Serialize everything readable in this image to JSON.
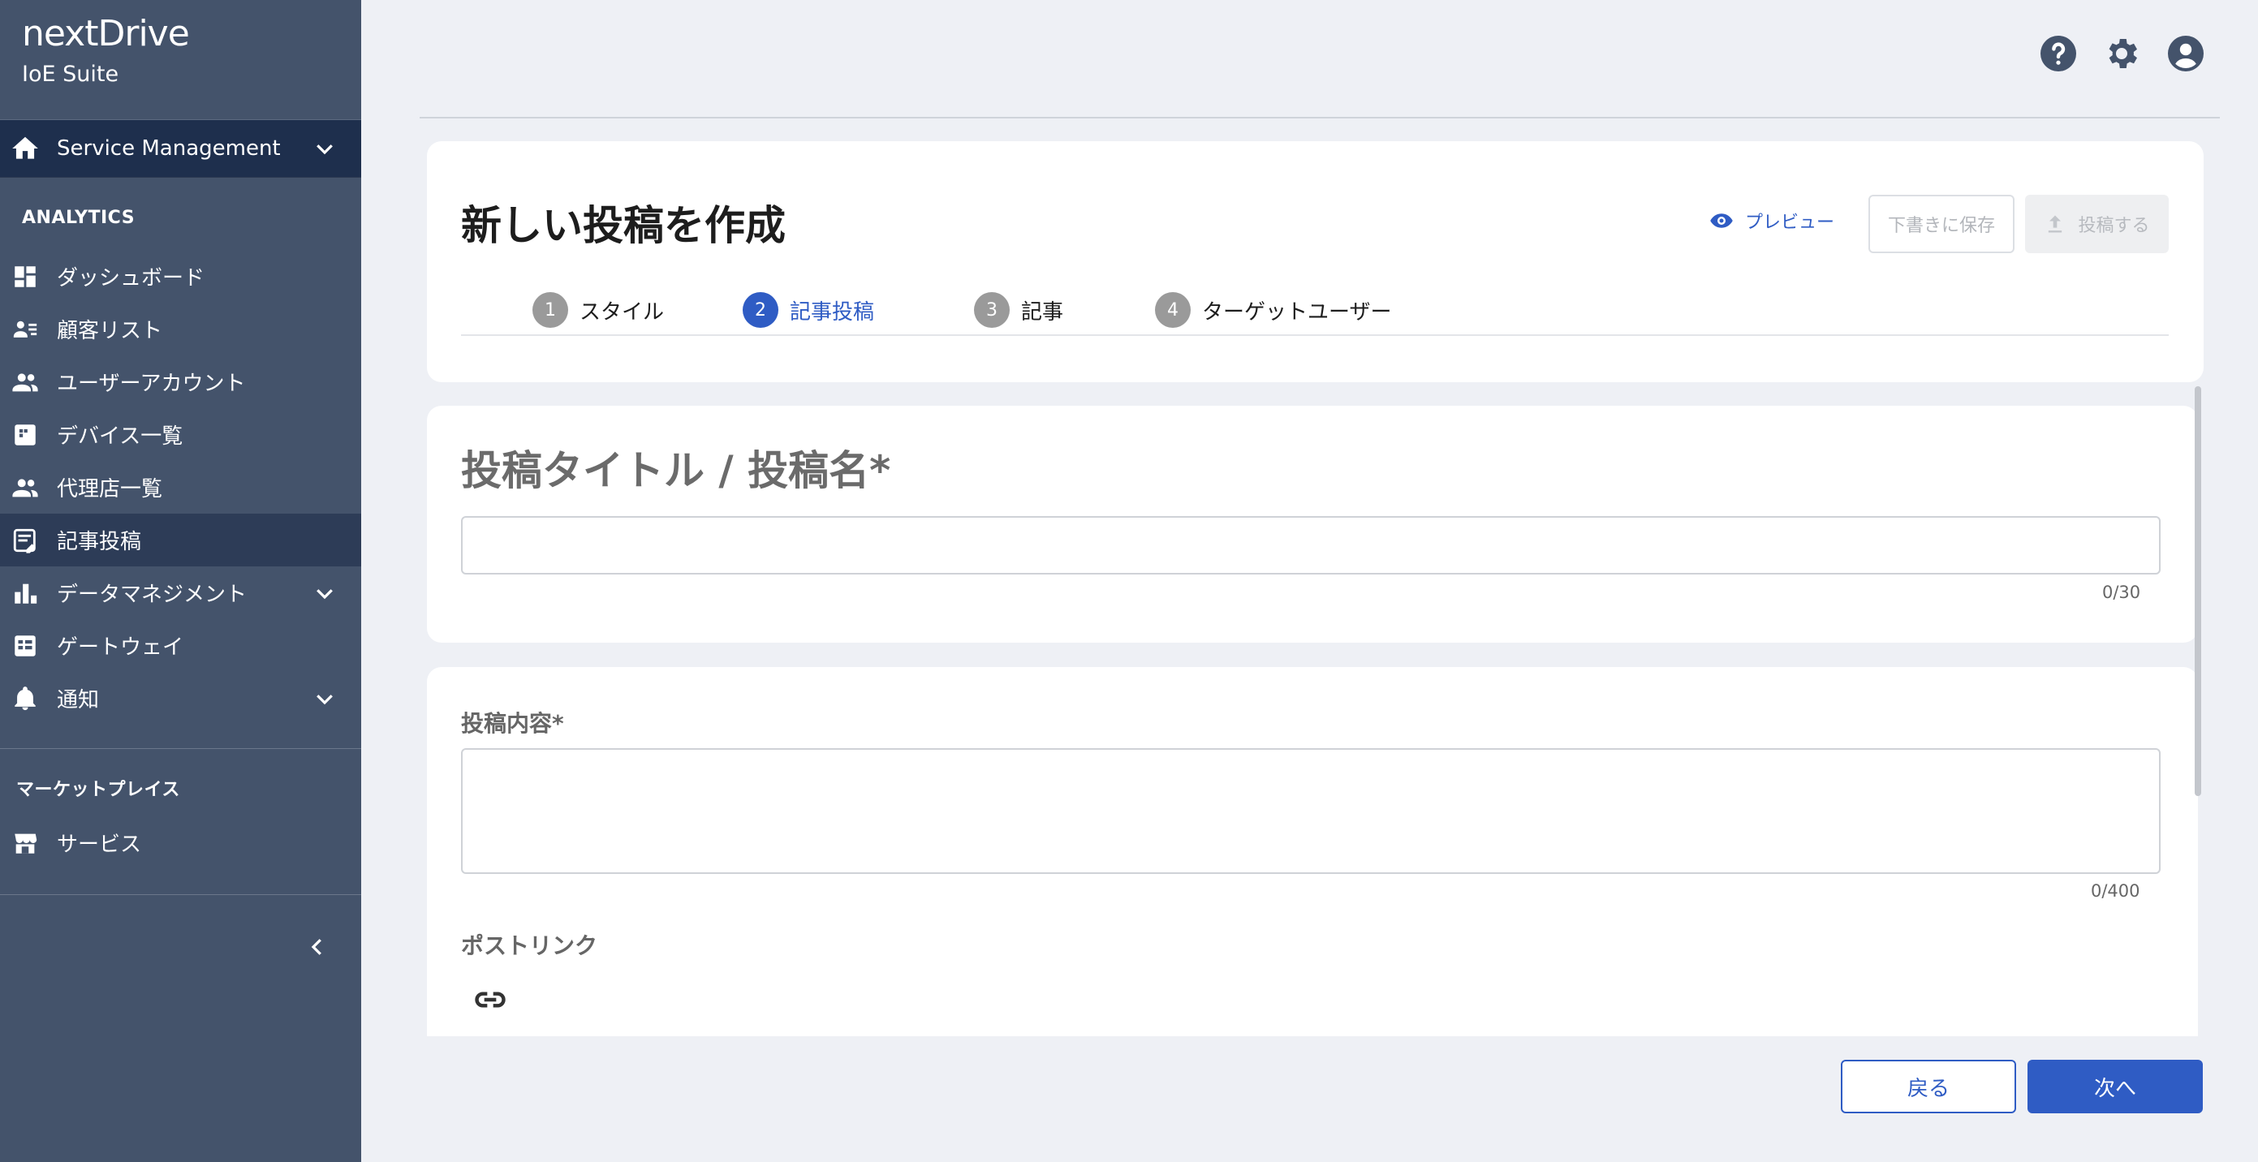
{
  "brand": {
    "logo": "nextDrive",
    "subtitle": "IoE Suite"
  },
  "sidebar": {
    "service_menu": {
      "label": "Service Management",
      "icon": "home-icon"
    },
    "analytics_heading": "ANALYTICS",
    "items": [
      {
        "label": "ダッシュボード",
        "icon": "dashboard-icon",
        "expandable": false,
        "active": false
      },
      {
        "label": "顧客リスト",
        "icon": "customer-list-icon",
        "expandable": false,
        "active": false
      },
      {
        "label": "ユーザーアカウント",
        "icon": "users-icon",
        "expandable": false,
        "active": false
      },
      {
        "label": "デバイス一覧",
        "icon": "device-icon",
        "expandable": false,
        "active": false
      },
      {
        "label": "代理店一覧",
        "icon": "agency-icon",
        "expandable": false,
        "active": false
      },
      {
        "label": "記事投稿",
        "icon": "article-icon",
        "expandable": false,
        "active": true
      },
      {
        "label": "データマネジメント",
        "icon": "bar-chart-icon",
        "expandable": true,
        "active": false
      },
      {
        "label": "ゲートウェイ",
        "icon": "gateway-icon",
        "expandable": false,
        "active": false
      },
      {
        "label": "通知",
        "icon": "bell-icon",
        "expandable": true,
        "active": false
      }
    ],
    "marketplace_heading": "マーケットプレイス",
    "marketplace_items": [
      {
        "label": "サービス",
        "icon": "store-icon"
      }
    ]
  },
  "topbar": {
    "icons": [
      "help-icon",
      "settings-icon",
      "account-icon"
    ]
  },
  "header": {
    "title": "新しい投稿を作成",
    "preview_label": "プレビュー",
    "save_draft_label": "下書きに保存",
    "publish_label": "投稿する"
  },
  "steps": [
    {
      "num": "1",
      "label": "スタイル"
    },
    {
      "num": "2",
      "label": "記事投稿"
    },
    {
      "num": "3",
      "label": "記事"
    },
    {
      "num": "4",
      "label": "ターゲットユーザー"
    }
  ],
  "form": {
    "title_label": "投稿タイトル / 投稿名*",
    "title_value": "",
    "title_counter": "0/30",
    "body_label": "投稿内容*",
    "body_value": "",
    "body_counter": "0/400",
    "link_label": "ポストリンク"
  },
  "footer": {
    "back_label": "戻る",
    "next_label": "次へ"
  },
  "colors": {
    "sidebar": "#44536b",
    "accent": "#2f5cc4",
    "active_row": "#2d3c57"
  }
}
